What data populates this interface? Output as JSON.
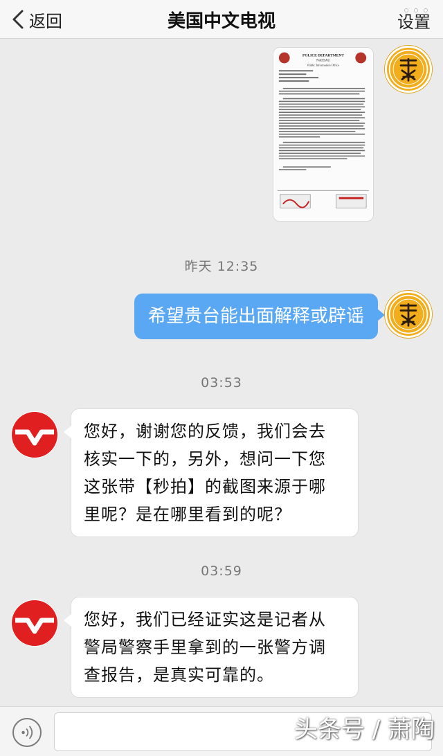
{
  "header": {
    "back_label": "返回",
    "title": "美国中文电视",
    "settings_label": "设置"
  },
  "messages": [
    {
      "type": "image",
      "from": "me",
      "image_text": {
        "heading": "POLICE DEPARTMENT",
        "sub": "NASSAU",
        "office": "Public Information Office"
      }
    },
    {
      "type": "time",
      "text": "昨天 12:35"
    },
    {
      "type": "text",
      "from": "me",
      "text": "希望贵台能出面解释或辟谣"
    },
    {
      "type": "time",
      "text": "03:53"
    },
    {
      "type": "text",
      "from": "station",
      "lines": [
        "您好，谢谢您的反馈，我们会去",
        "核实一下的，另外，想问一下您",
        "这张带【秒拍】的截图来源于哪",
        "里呢？是在哪里看到的呢？"
      ]
    },
    {
      "type": "time",
      "text": "03:59"
    },
    {
      "type": "text",
      "from": "station",
      "lines": [
        "您好，我们已经证实这是记者从",
        "警局警察手里拿到的一张警方调",
        "查报告，是真实可靠的。"
      ]
    }
  ],
  "watermark": "头条号 / 萧陶",
  "colors": {
    "outgoing_bubble": "#5aa8f4",
    "station_avatar_red": "#e02020",
    "user_avatar_gold": "#f1ad1c"
  },
  "icons": {
    "back": "chevron-left-icon",
    "voice": "voice-wave-icon"
  }
}
